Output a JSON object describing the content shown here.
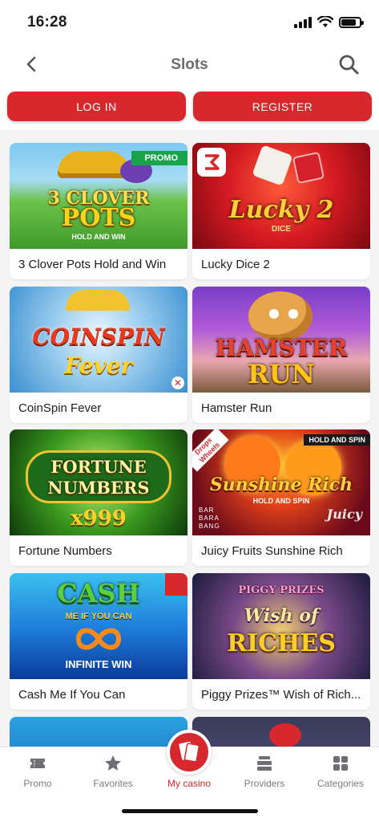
{
  "status_bar": {
    "time": "16:28"
  },
  "nav": {
    "title": "Slots"
  },
  "auth": {
    "login_label": "LOG IN",
    "register_label": "REGISTER"
  },
  "games": [
    {
      "title": "3 Clover Pots Hold and Win",
      "art_line1": "3 CLOVER",
      "art_line2": "POTS",
      "art_line3": "HOLD AND WIN",
      "badge": "PROMO"
    },
    {
      "title": "Lucky Dice 2",
      "art_line1": "Lucky 2",
      "art_line2": "DICE"
    },
    {
      "title": "CoinSpin Fever",
      "art_line1": "COINSPIN",
      "art_line2": "Fever"
    },
    {
      "title": "Hamster Run",
      "art_line1": "HAMSTER",
      "art_line2": "RUN"
    },
    {
      "title": "Fortune Numbers",
      "art_line1": "FORTUNE",
      "art_line2": "NUMBERS",
      "art_line3": "x999"
    },
    {
      "title": "Juicy Fruits Sunshine Rich",
      "art_line1": "Sunshine Rich",
      "art_line2": "HOLD AND SPIN",
      "art_line3": "Juicy",
      "badge": "HOLD AND SPIN",
      "corner": "Drops Wheels",
      "studio": "BAR BARA BANG"
    },
    {
      "title": "Cash Me If You Can",
      "art_line1": "CASH",
      "art_line2": "ME IF YOU CAN",
      "art_line3": "INFINITE WIN"
    },
    {
      "title": "Piggy Prizes™ Wish of Rich...",
      "art_line1": "PIGGY PRIZES",
      "art_line2": "Wish of",
      "art_line3": "RICHES"
    }
  ],
  "tabs": [
    {
      "label": "Promo"
    },
    {
      "label": "Favorites"
    },
    {
      "label": "My casino"
    },
    {
      "label": "Providers"
    },
    {
      "label": "Categories"
    }
  ],
  "colors": {
    "brand_red": "#d7282e",
    "promo_green": "#19a34a",
    "inactive_tab": "#7c7c82"
  }
}
